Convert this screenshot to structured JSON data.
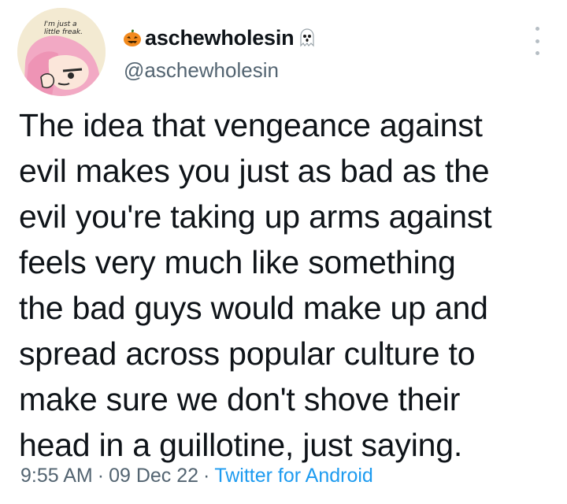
{
  "avatar": {
    "caption": "I'm just a little freak."
  },
  "author": {
    "display_name": "aschewholesin",
    "handle": "@aschewholesin",
    "name_prefix_icon": "jack-o-lantern-icon",
    "name_suffix_icon": "ghost-icon"
  },
  "tweet": {
    "lines": [
      "The idea that vengeance against",
      "evil makes you just as bad as the",
      "evil you're taking up arms against",
      "feels very much like something",
      "the bad guys would make up and",
      "spread across popular culture to",
      "make sure we don't shove their",
      "head in a guillotine, just saying."
    ],
    "time": "9:55 AM",
    "date": "09 Dec 22",
    "source": "Twitter for Android",
    "separator": "·"
  },
  "colors": {
    "text": "#0f1419",
    "secondary": "#536471",
    "link": "#1d9bf0"
  }
}
